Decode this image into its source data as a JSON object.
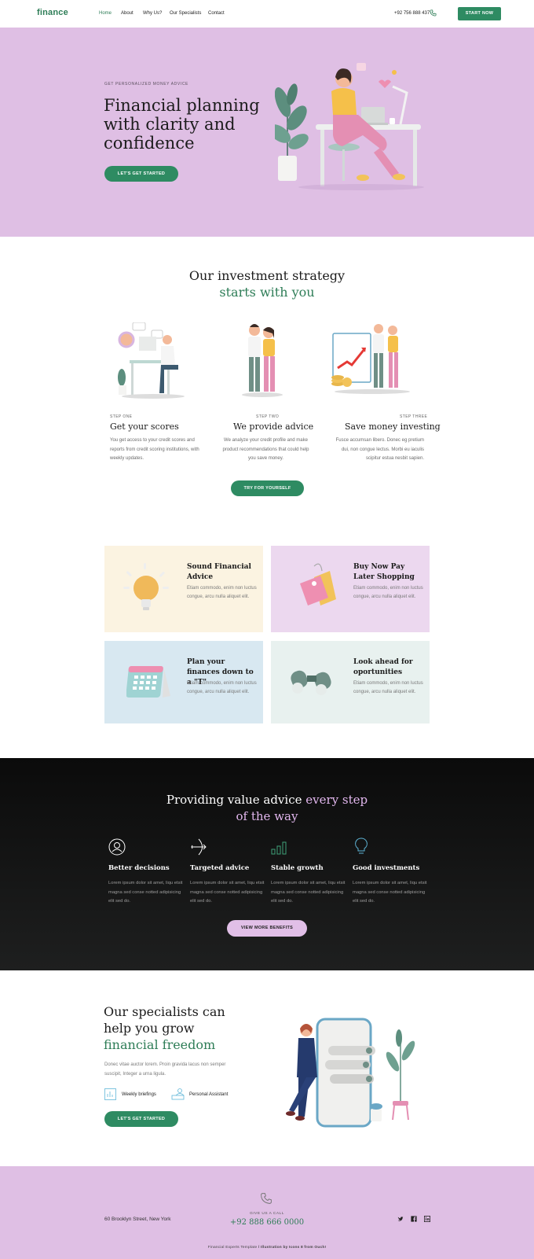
{
  "nav": {
    "logo": "finance",
    "links": [
      "Home",
      "About",
      "Why Us?",
      "Our Specialists",
      "Contact"
    ],
    "phone": "+92 756 888 437",
    "cta": "START NOW"
  },
  "hero": {
    "eyebrow": "GET PERSONALIZED MONEY ADVICE",
    "title": "Financial planning with clarity and confidence",
    "cta": "LET'S GET STARTED",
    "illustration_icon": "woman-at-desk-illustration"
  },
  "strategy": {
    "title_line1": "Our investment strategy",
    "title_line2": "starts with you",
    "steps": [
      {
        "label": "STEP ONE",
        "title": "Get your scores",
        "desc": "You get access to your credit scores and reports from credit scoring institutions, with weekly updates."
      },
      {
        "label": "STEP TWO",
        "title": "We provide advice",
        "desc": "We analyze your credit profile and make product recommendations that could help you save money."
      },
      {
        "label": "STEP THREE",
        "title": "Save money investing",
        "desc": "Fusce accumsan libero. Donec eg pretium dui, non congue lectus. Morbi eu iaculis scipitur estua nesbit sapien."
      }
    ],
    "cta": "TRY FOR YOURSELF"
  },
  "features": [
    {
      "title": "Sound Financial Advice",
      "desc": "Etiam commodo, enim non luctus congue, arcu nulla aliquet elit.",
      "icon": "lightbulb-icon",
      "bg": "#fbf3e1"
    },
    {
      "title": "Buy Now Pay Later Shopping",
      "desc": "Etiam commodo, enim non luctus congue, arcu nulla aliquet elit.",
      "icon": "price-tag-icon",
      "bg": "#ecd8ef"
    },
    {
      "title": "Plan your finances down to a \"T\"",
      "desc": "Etiam commodo, enim non luctus congue, arcu nulla aliquet elit.",
      "icon": "calendar-icon",
      "bg": "#d8e8f1"
    },
    {
      "title": "Look ahead for oportunities",
      "desc": "Etiam commodo, enim non luctus congue, arcu nulla aliquet elit.",
      "icon": "binoculars-icon",
      "bg": "#e8f1ef"
    }
  ],
  "benefits": {
    "title_white": "Providing value advice ",
    "title_pink1": "every step",
    "title_pink2": "of the way",
    "items": [
      {
        "title": "Better decisions",
        "desc": "Lorem ipsum dolor sit amet, liqu etsit magna sed conse notted adipisicing elit sed do.",
        "icon": "user-circle-icon"
      },
      {
        "title": "Targeted advice",
        "desc": "Lorem ipsum dolor sit amet, liqu etsit magna sed conse notted adipisicing elit sed do.",
        "icon": "target-arrow-icon"
      },
      {
        "title": "Stable growth",
        "desc": "Lorem ipsum dolor sit amet, liqu etsit magna sed conse notted adipisicing elit sed do.",
        "icon": "bar-chart-icon"
      },
      {
        "title": "Good investments",
        "desc": "Lorem ipsum dolor sit amet, liqu etsit magna sed conse notted adipisicing elit sed do.",
        "icon": "lightbulb-outline-icon"
      }
    ],
    "cta": "VIEW MORE BENEFITS"
  },
  "specialists": {
    "title_part1": "Our specialists can help you grow ",
    "title_green": "financial freedom",
    "desc": "Donec vitae auctor lorem. Proin gravida lacus non semper suscipit, Integer a urna ligula.",
    "feature1": "Weekly briefings",
    "feature2": "Personal Assistant",
    "cta": "LET'S GET STARTED"
  },
  "footer": {
    "address": "60 Brooklyn Street, New York",
    "call_label": "GIVE US A CALL",
    "phone": "+92 888 666 0000",
    "credit_part1": "Financial Experts Template",
    "credit_part2": " / Illustration by Icons 8 from Ouch!",
    "social": [
      "twitter-icon",
      "facebook-icon",
      "linkedin-icon"
    ]
  },
  "colors": {
    "brand_green": "#2e8b62",
    "lavender": "#dfbfe4",
    "dark": "#121212"
  }
}
